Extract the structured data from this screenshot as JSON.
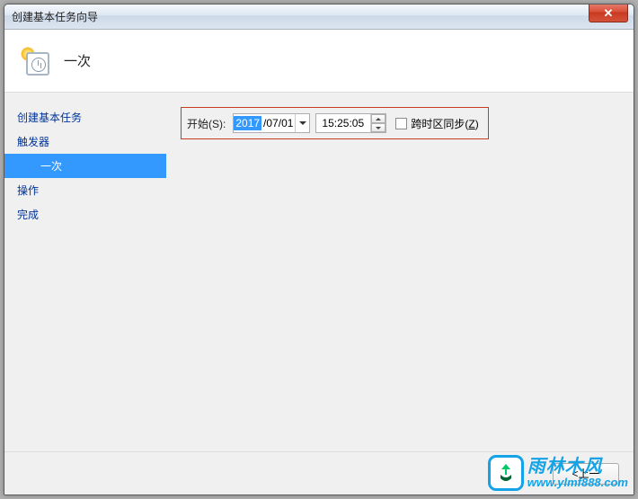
{
  "window": {
    "title": "创建基本任务向导"
  },
  "header": {
    "title": "一次"
  },
  "sidebar": {
    "items": [
      {
        "label": "创建基本任务",
        "indent": false,
        "selected": false
      },
      {
        "label": "触发器",
        "indent": false,
        "selected": false
      },
      {
        "label": "一次",
        "indent": true,
        "selected": true
      },
      {
        "label": "操作",
        "indent": false,
        "selected": false
      },
      {
        "label": "完成",
        "indent": false,
        "selected": false
      }
    ]
  },
  "form": {
    "start_label": "开始(S):",
    "date": {
      "year": "2017",
      "rest": "/07/01"
    },
    "time": "15:25:05",
    "sync_label": "跨时区同步(Z)",
    "sync_checked": false
  },
  "footer": {
    "back": "<上一"
  },
  "watermark": {
    "cn": "雨林木风",
    "url": "www.ylmf888.com"
  }
}
